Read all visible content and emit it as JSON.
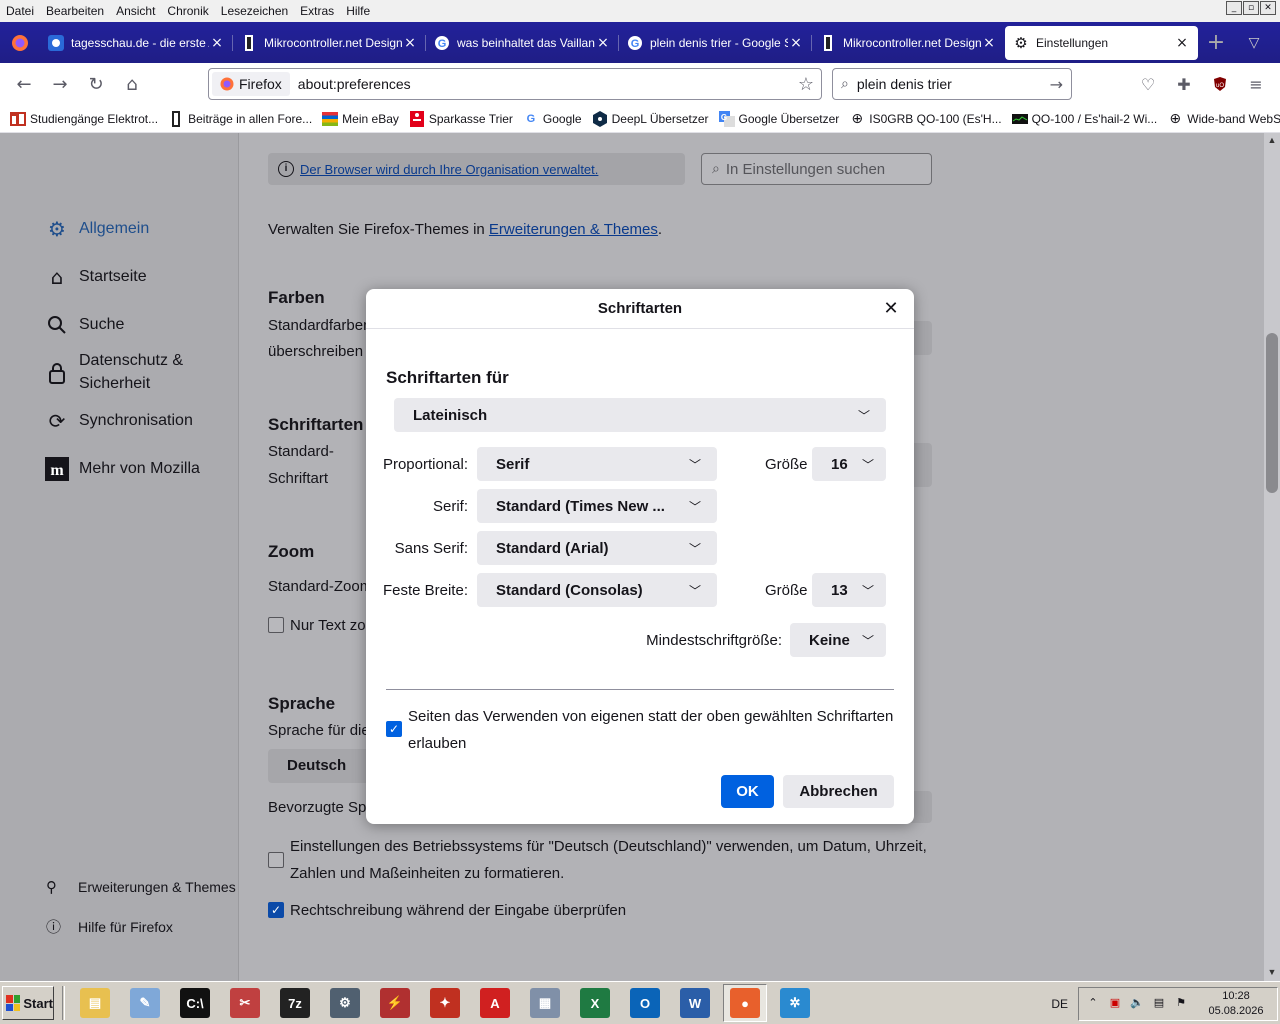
{
  "menubar": {
    "items": [
      "Datei",
      "Bearbeiten",
      "Ansicht",
      "Chronik",
      "Lesezeichen",
      "Extras",
      "Hilfe"
    ]
  },
  "window_controls": [
    "_",
    "▫",
    "✕"
  ],
  "tabs": [
    {
      "label": "tagesschau.de - die erste A",
      "icon": "tagesschau-icon"
    },
    {
      "label": "Mikrocontroller.net Design-U",
      "icon": "mikrocontroller-icon"
    },
    {
      "label": "was beinhaltet das Vailland V",
      "icon": "google-icon"
    },
    {
      "label": "plein denis trier - Google Suc",
      "icon": "google-icon"
    },
    {
      "label": "Mikrocontroller.net Design-U",
      "icon": "mikrocontroller-icon"
    },
    {
      "label": "Einstellungen",
      "icon": "gear-icon",
      "active": true
    }
  ],
  "navbar": {
    "identity_label": "Firefox",
    "url": "about:preferences",
    "search_text": "plein denis trier"
  },
  "bookmarks": [
    {
      "label": "Studiengänge Elektrot...",
      "icon": "hs-trier-icon"
    },
    {
      "label": "Beiträge in allen Fore...",
      "icon": "mikrocontroller-icon"
    },
    {
      "label": "Mein eBay",
      "icon": "ebay-icon"
    },
    {
      "label": "Sparkasse Trier",
      "icon": "sparkasse-icon"
    },
    {
      "label": "Google",
      "icon": "google-icon"
    },
    {
      "label": "DeepL Übersetzer",
      "icon": "deepl-icon"
    },
    {
      "label": "Google Übersetzer",
      "icon": "translate-icon"
    },
    {
      "label": "IS0GRB QO-100 (Es'H...",
      "icon": "globe-icon"
    },
    {
      "label": "QO-100 / Es'hail-2 Wi...",
      "icon": "websdr-icon"
    },
    {
      "label": "Wide-band WebSDR i...",
      "icon": "globe-icon"
    }
  ],
  "sidebar": {
    "categories": [
      {
        "label": "Allgemein",
        "icon": "gear-icon",
        "selected": true
      },
      {
        "label": "Startseite",
        "icon": "home-icon"
      },
      {
        "label": "Suche",
        "icon": "search-icon"
      },
      {
        "label": "Datenschutz &",
        "label2": "Sicherheit",
        "icon": "lock-icon"
      },
      {
        "label": "Synchronisation",
        "icon": "sync-icon"
      },
      {
        "label": "Mehr von Mozilla",
        "icon": "mozilla-icon"
      }
    ],
    "footer": [
      {
        "label": "Erweiterungen & Themes",
        "icon": "puzzle-icon"
      },
      {
        "label": "Hilfe für Firefox",
        "icon": "help-icon"
      }
    ]
  },
  "main": {
    "policy_text": "Der Browser wird durch Ihre Organisation verwaltet.",
    "search_placeholder": "In Einstellungen suchen",
    "themes_text": "Verwalten Sie Firefox-Themes in ",
    "themes_link": "Erweiterungen & Themes",
    "themes_dot": ".",
    "farben_heading": "Farben",
    "farben_text1": "Standardfarben",
    "farben_text2": "überschreiben",
    "schriftarten_heading": "Schriftarten",
    "schrift_text1": "Standard-",
    "schrift_text2": "Schriftart",
    "zoom_heading": "Zoom",
    "zoom_text": "Standard-Zoom",
    "zoom_checkbox": "Nur Text zo",
    "sprache_heading": "Sprache",
    "sprache_text": "Sprache für die",
    "sprache_button": "Deutsch",
    "bevorzugte": "Bevorzugte Spr",
    "os_settings": "Einstellungen des Betriebssystems für \"Deutsch (Deutschland)\" verwenden, um Datum, Uhrzeit,",
    "os_settings2": "Zahlen und Maßeinheiten zu formatieren.",
    "spellcheck": "Rechtschreibung während der Eingabe überprüfen"
  },
  "dialog": {
    "title": "Schriftarten",
    "heading": "Schriftarten für",
    "script_select": "Lateinisch",
    "proportional_label": "Proportional:",
    "proportional_value": "Serif",
    "size_label": "Größe",
    "proportional_size": "16",
    "serif_label": "Serif:",
    "serif_value": "Standard (Times New ...",
    "sans_label": "Sans Serif:",
    "sans_value": "Standard (Arial)",
    "mono_label": "Feste Breite:",
    "mono_value": "Standard (Consolas)",
    "mono_size_label": "Größe",
    "mono_size": "13",
    "min_size_label": "Mindestschriftgröße:",
    "min_size_value": "Keine",
    "allow_fonts_text": "Seiten das Verwenden von eigenen statt der oben gewählten Schriftarten erlauben",
    "ok": "OK",
    "cancel": "Abbrechen"
  },
  "taskbar": {
    "start": "Start",
    "apps": [
      {
        "name": "explorer-icon",
        "color": "#e8c050",
        "glyph": "▤"
      },
      {
        "name": "notepad-icon",
        "color": "#7fa8d8",
        "glyph": "✎"
      },
      {
        "name": "cmd-icon",
        "color": "#111111",
        "glyph": "C:\\"
      },
      {
        "name": "snipping-icon",
        "color": "#c04040",
        "glyph": "✂"
      },
      {
        "name": "7zip-icon",
        "color": "#222222",
        "glyph": "7z"
      },
      {
        "name": "device-manager-icon",
        "color": "#506070",
        "glyph": "⚙"
      },
      {
        "name": "oscilloscope-icon",
        "color": "#b03030",
        "glyph": "⚡"
      },
      {
        "name": "eagle-icon",
        "color": "#c03020",
        "glyph": "✦"
      },
      {
        "name": "acrobat-icon",
        "color": "#d02020",
        "glyph": "A"
      },
      {
        "name": "calculator-icon",
        "color": "#8090a8",
        "glyph": "▦"
      },
      {
        "name": "excel-icon",
        "color": "#1f7a42",
        "glyph": "X"
      },
      {
        "name": "outlook-icon",
        "color": "#0a64b8",
        "glyph": "O"
      },
      {
        "name": "word-icon",
        "color": "#2b5ea8",
        "glyph": "W"
      },
      {
        "name": "firefox-icon",
        "color": "#e8602c",
        "glyph": "●"
      },
      {
        "name": "network-tool-icon",
        "color": "#2a8ad0",
        "glyph": "✲"
      }
    ],
    "lang": "DE",
    "time": "10:28",
    "date": "05.08.2026"
  }
}
